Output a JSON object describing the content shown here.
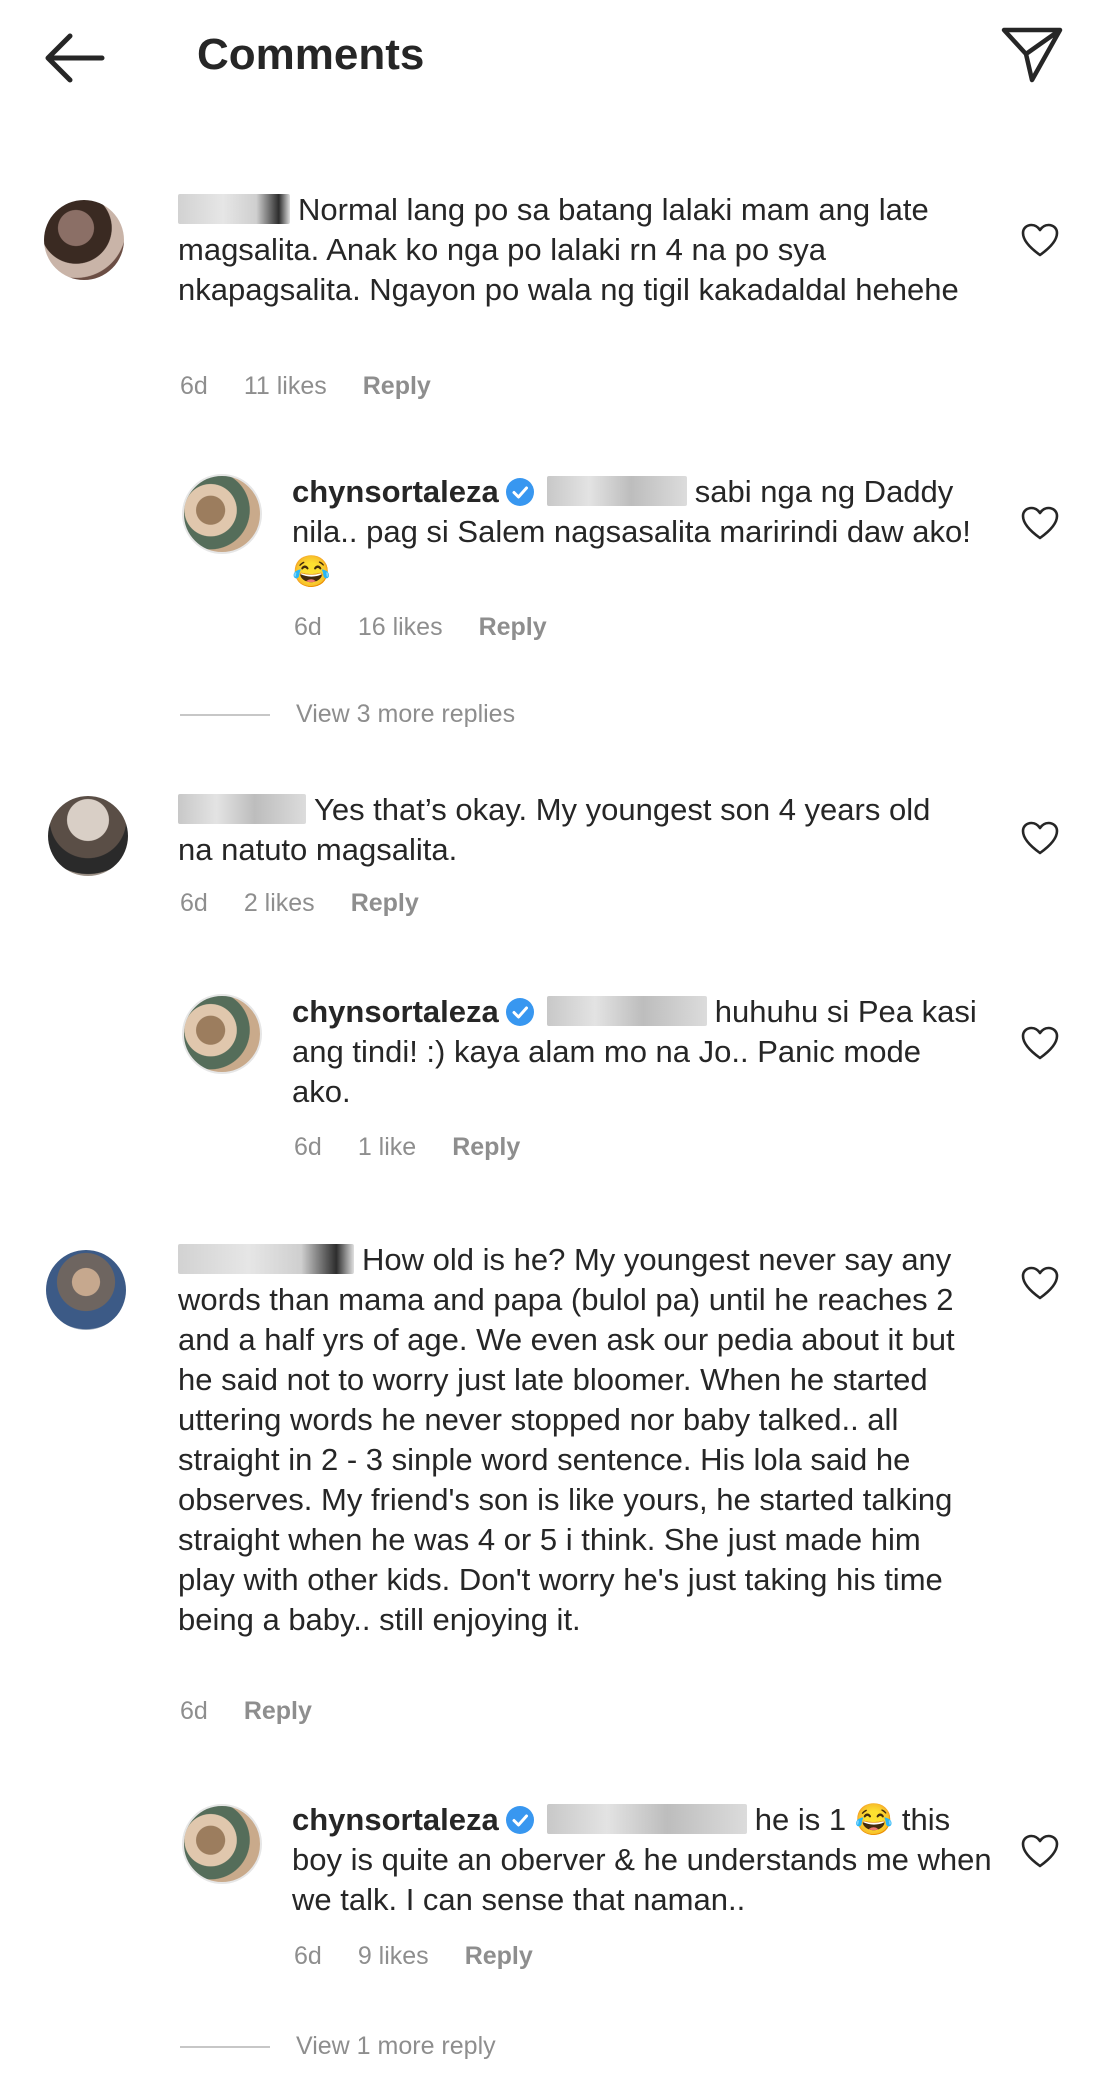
{
  "header": {
    "title": "Comments"
  },
  "icons": {
    "back": "arrow-left-icon",
    "send": "paper-plane-icon",
    "like": "heart-outline-icon",
    "verified": "verified-badge-icon"
  },
  "colors": {
    "verified": "#3897f0",
    "meta": "#8e8e8e",
    "text": "#262626"
  },
  "comments": [
    {
      "text": "Normal lang po sa batang lalaki mam ang late magsalita. Anak ko nga po lalaki rn 4 na po sya nkapagsalita. Ngayon po wala ng tigil kakadaldal hehehe",
      "time": "6d",
      "likes": "11 likes",
      "reply": "Reply"
    },
    {
      "username": "chynsortaleza",
      "text": "sabi nga ng Daddy nila.. pag si Salem nagsasalita maririndi daw ako! 😂",
      "time": "6d",
      "likes": "16 likes",
      "reply": "Reply"
    },
    {
      "view_more": "View 3 more replies"
    },
    {
      "text": "Yes that’s okay. My youngest son 4 years old na natuto magsalita.",
      "time": "6d",
      "likes": "2 likes",
      "reply": "Reply"
    },
    {
      "username": "chynsortaleza",
      "text": "huhuhu si Pea kasi ang tindi! :) kaya alam mo na Jo.. Panic mode ako.",
      "time": "6d",
      "likes": "1 like",
      "reply": "Reply"
    },
    {
      "text": "How old is he? My youngest never say any words than mama and papa (bulol pa)  until he reaches 2 and a half yrs of age. We even ask our pedia about it but he said not to worry just late bloomer. When he started uttering words he never stopped nor baby talked.. all straight in 2 - 3 sinple word sentence.  His lola said he observes. My friend's son is like yours, he started talking straight when he was 4 or 5 i think. She just made him play with other kids. Don't worry he's just taking his time being a baby.. still enjoying it.",
      "time": "6d",
      "reply": "Reply"
    },
    {
      "username": "chynsortaleza",
      "text": "he is 1 😂 this boy is quite an oberver & he understands me when we talk. I can sense that naman..",
      "time": "6d",
      "likes": "9 likes",
      "reply": "Reply"
    },
    {
      "view_more": "View 1 more reply"
    }
  ]
}
